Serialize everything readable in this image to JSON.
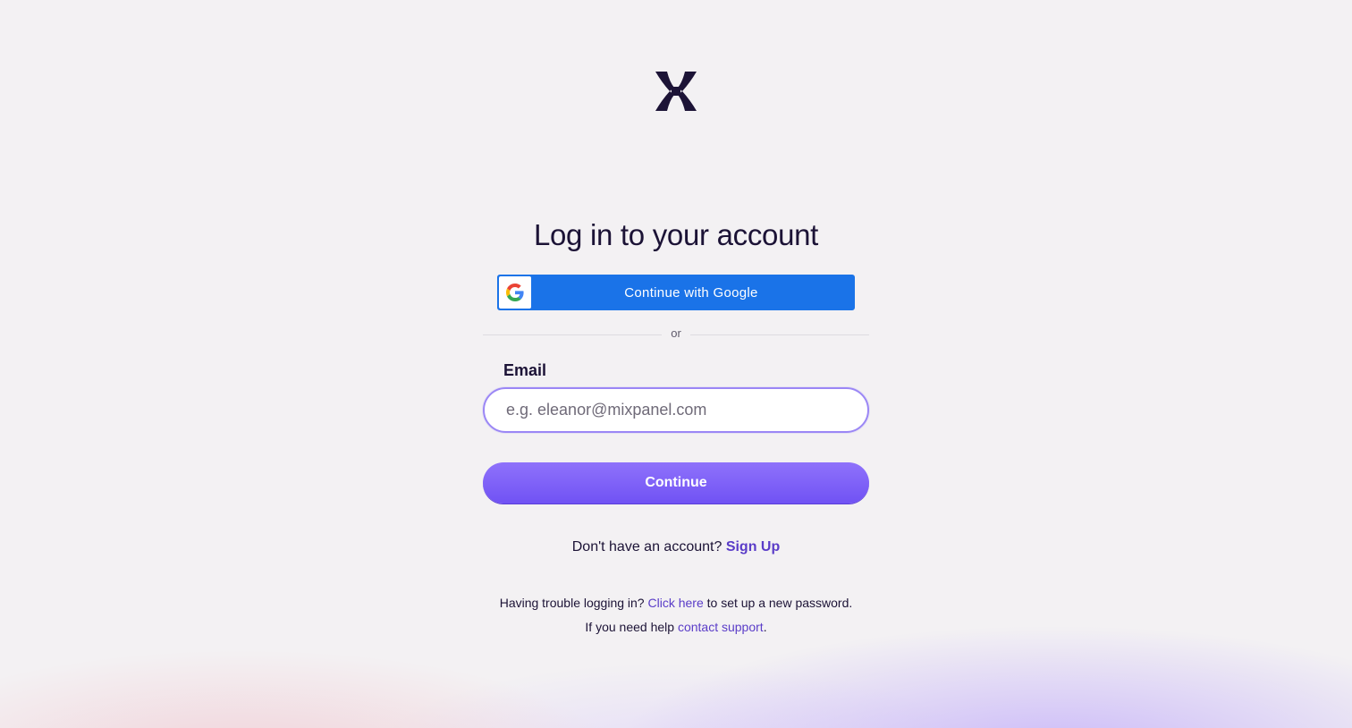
{
  "page": {
    "title": "Log in to your account",
    "logo_icon": "mixpanel-logo-icon"
  },
  "google": {
    "label": "Continue with Google",
    "icon": "google-g-icon",
    "color": "#1a73e8"
  },
  "divider": {
    "text": "or"
  },
  "email": {
    "label": "Email",
    "placeholder": "e.g. eleanor@mixpanel.com",
    "value": ""
  },
  "continue": {
    "label": "Continue",
    "color": "#7c5cf8"
  },
  "signup": {
    "prompt": "Don't have an account?",
    "link": "Sign Up"
  },
  "help": {
    "trouble_prefix": "Having trouble logging in?",
    "trouble_link": "Click here",
    "trouble_suffix": "to set up a new password.",
    "support_prefix": "If you need help",
    "support_link": "contact support",
    "support_suffix": "."
  }
}
